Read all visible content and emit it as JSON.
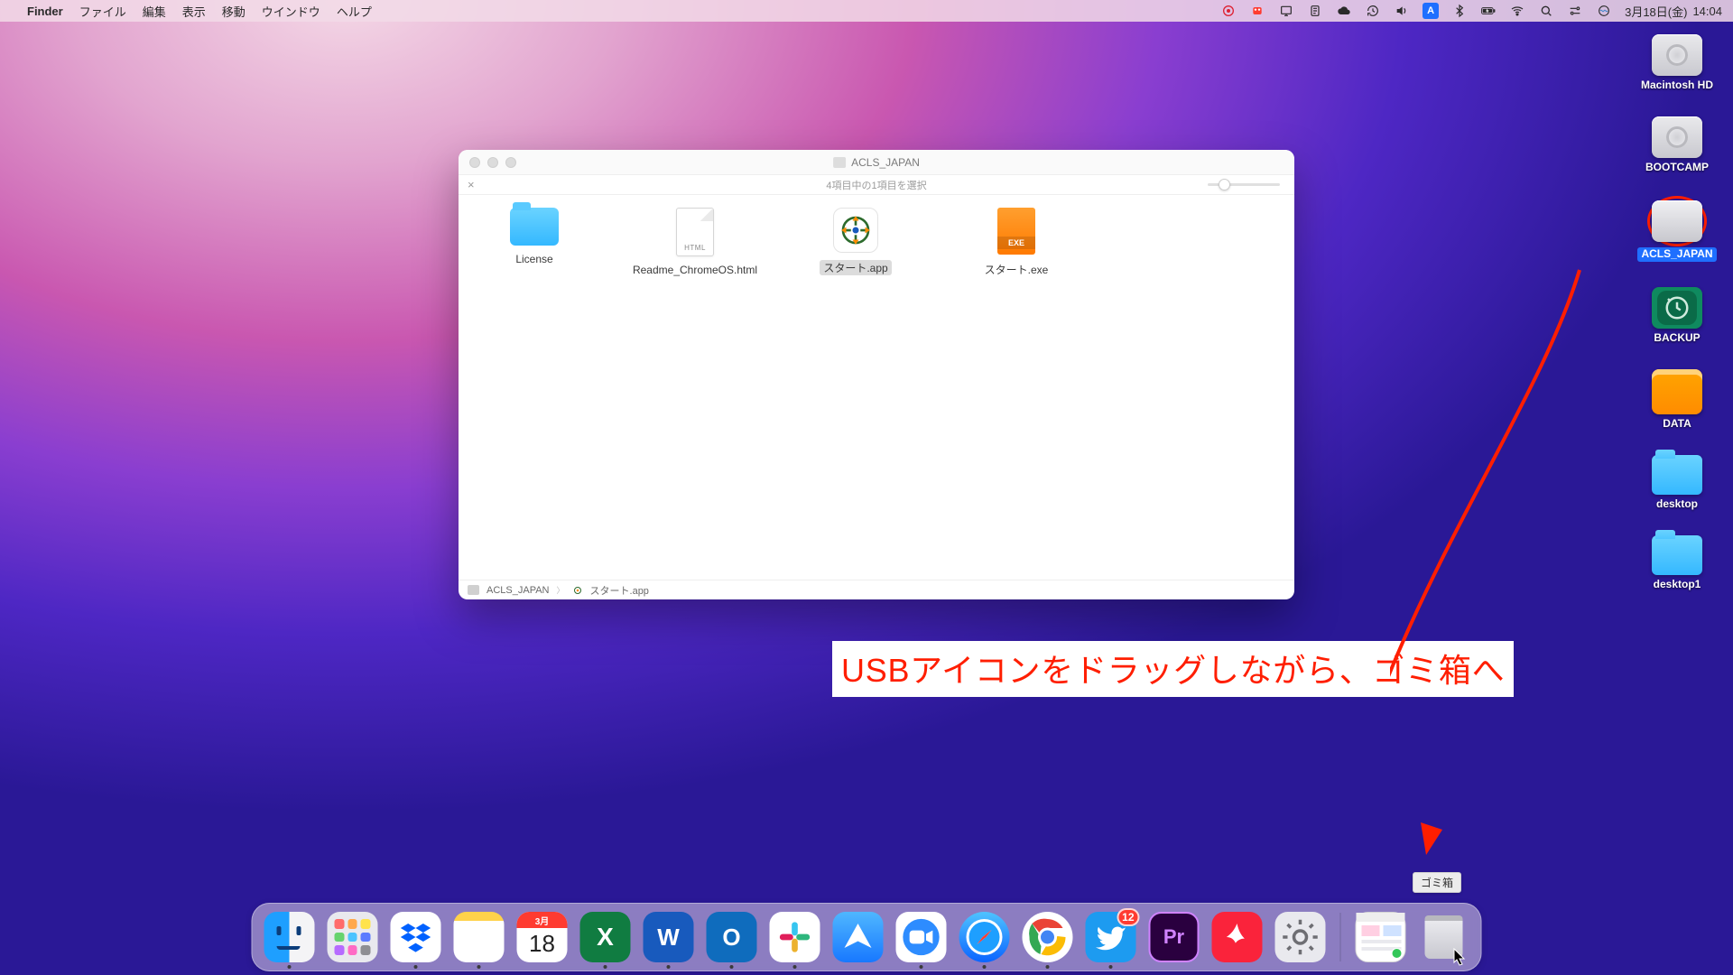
{
  "menubar": {
    "app": "Finder",
    "menus": [
      "ファイル",
      "編集",
      "表示",
      "移動",
      "ウインドウ",
      "ヘルプ"
    ],
    "lang_badge": "A",
    "date": "3月18日(金)",
    "time": "14:04"
  },
  "desktop_icons": [
    {
      "name": "Macintosh HD",
      "kind": "hd"
    },
    {
      "name": "BOOTCAMP",
      "kind": "hd"
    },
    {
      "name": "ACLS_JAPAN",
      "kind": "usb",
      "selected": true
    },
    {
      "name": "BACKUP",
      "kind": "tm"
    },
    {
      "name": "DATA",
      "kind": "ext"
    },
    {
      "name": "desktop",
      "kind": "folder"
    },
    {
      "name": "desktop1",
      "kind": "folder"
    }
  ],
  "finder": {
    "title": "ACLS_JAPAN",
    "status": "4項目中の1項目を選択",
    "items": [
      {
        "name": "License",
        "kind": "folder"
      },
      {
        "name": "Readme_ChromeOS.html",
        "kind": "html"
      },
      {
        "name": "スタート.app",
        "kind": "app",
        "selected": true
      },
      {
        "name": "スタート.exe",
        "kind": "exe"
      }
    ],
    "exe_badge": "EXE",
    "html_badge": "HTML",
    "path": {
      "root": "ACLS_JAPAN",
      "leaf": "スタート.app"
    }
  },
  "annotation": {
    "text": "USBアイコンをドラッグしながら、ゴミ箱へ",
    "tooltip": "ゴミ箱"
  },
  "dock": {
    "calendar": {
      "month": "3月",
      "day": "18"
    },
    "twitter_badge": "12",
    "apps": [
      "finder",
      "launchpad",
      "dropbox",
      "notes",
      "calendar",
      "excel",
      "word",
      "outlook",
      "slack",
      "fleet",
      "zoom",
      "safari",
      "chrome",
      "twitter",
      "premiere",
      "acrobat",
      "sysprefs"
    ],
    "premiere_label": "Pr",
    "excel_label": "X",
    "word_label": "W",
    "outlook_label": "O"
  }
}
